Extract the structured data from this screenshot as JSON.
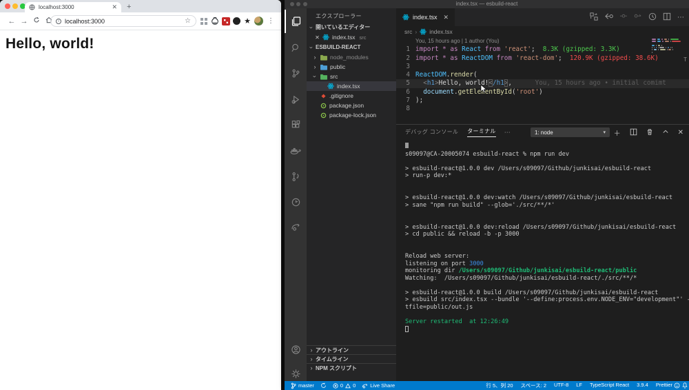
{
  "colors": {
    "statusbar": "#007ACC",
    "accent_blue": "#3B8EEA",
    "accent_green": "#1FBD77",
    "import_ok": "#4EC94E",
    "import_big": "#F14C4C",
    "react_icon": "#00B7E3"
  },
  "browser": {
    "tab_title": "localhost:3000",
    "url": "localhost:3000",
    "heading": "Hello, world!",
    "toolbar_icons": [
      "back",
      "forward",
      "reload",
      "home",
      "star",
      "grid-extension",
      "github-extension",
      "red-extension",
      "dot-extension",
      "star-extension",
      "avatar",
      "menu"
    ]
  },
  "vscode": {
    "window_title": "index.tsx — esbuild-react",
    "activity_icons": [
      "explorer",
      "search",
      "source-control",
      "run-debug",
      "extensions",
      "docker",
      "gitlens",
      "timer",
      "live-share",
      "account",
      "settings"
    ],
    "explorer": {
      "title": "エクスプローラー",
      "open_editors_label": "開いているエディター",
      "workspace_label": "ESBUILD-REACT",
      "open_editor": {
        "file": "index.tsx",
        "folder": "src"
      },
      "tree": [
        {
          "chev": ">",
          "icon": "folder-green",
          "label": "node_modules",
          "dim": true,
          "indent": 8
        },
        {
          "chev": ">",
          "icon": "folder-blue",
          "label": "public",
          "indent": 8
        },
        {
          "chev": "v",
          "icon": "folder-green2",
          "label": "src",
          "indent": 8
        },
        {
          "icon": "react",
          "label": "index.tsx",
          "selected": true,
          "indent": 30
        },
        {
          "icon": "git",
          "label": ".gitignore",
          "indent": 20
        },
        {
          "icon": "npm",
          "label": "package.json",
          "indent": 20
        },
        {
          "icon": "npm",
          "label": "package-lock.json",
          "indent": 20
        }
      ],
      "bottom_sections": [
        "アウトライン",
        "タイムライン",
        "NPM スクリプト"
      ]
    },
    "editor": {
      "tab_label": "index.tsx",
      "breadcrumb": [
        "src",
        "index.tsx"
      ],
      "code": [
        {
          "n": "",
          "seg": [
            [
              "lens",
              "You, 15 hours ago | 1 author (You)"
            ]
          ],
          "lens": true
        },
        {
          "n": "1",
          "seg": [
            [
              "kw",
              "import * as"
            ],
            [
              "ty",
              " React "
            ],
            [
              "kw",
              "from"
            ],
            [
              "st",
              " 'react'"
            ],
            [
              "pl",
              ";"
            ],
            [
              "ang",
              "  8.3K (gzipped: 3.3K)"
            ]
          ]
        },
        {
          "n": "2",
          "seg": [
            [
              "kw",
              "import * as"
            ],
            [
              "ty",
              " ReactDOM "
            ],
            [
              "kw",
              "from"
            ],
            [
              "st",
              " 'react-dom'"
            ],
            [
              "pl",
              ";"
            ],
            [
              "anr",
              "  120.9K (gzipped: 38.6K)"
            ]
          ]
        },
        {
          "n": "3",
          "seg": []
        },
        {
          "n": "4",
          "seg": [
            [
              "ty",
              "ReactDOM"
            ],
            [
              "pl",
              "."
            ],
            [
              "fn",
              "render"
            ],
            [
              "pl",
              "("
            ]
          ]
        },
        {
          "n": "5",
          "seg": [
            [
              "pl",
              "  "
            ],
            [
              "tb",
              "<"
            ],
            [
              "tg",
              "h1"
            ],
            [
              "tb",
              ">"
            ],
            [
              "tx",
              "Hello, world!"
            ],
            [
              "tbx",
              "<"
            ],
            [
              "tg",
              "/h1"
            ],
            [
              "tbx",
              ">"
            ],
            [
              "pl",
              ","
            ],
            [
              "blame",
              "      You, 15 hours ago • initial comimt"
            ]
          ],
          "current": true
        },
        {
          "n": "6",
          "seg": [
            [
              "pl",
              "  "
            ],
            [
              "vr",
              "document"
            ],
            [
              "pl",
              "."
            ],
            [
              "fn",
              "getElementById"
            ],
            [
              "pl",
              "("
            ],
            [
              "st",
              "'root'"
            ],
            [
              "pl",
              ")"
            ]
          ]
        },
        {
          "n": "7",
          "seg": [
            [
              "pl",
              ");"
            ]
          ]
        },
        {
          "n": "8",
          "seg": []
        }
      ]
    },
    "panel": {
      "tab_debug": "デバッグ コンソール",
      "tab_terminal": "ターミナル",
      "more": "⋯",
      "dropdown_value": "1: node",
      "terminal": [
        [
          [
            "blk",
            ""
          ]
        ],
        [
          [
            "t",
            "s09097@CA-20005074 esbuild-react % npm run dev"
          ]
        ],
        [],
        [
          [
            "t",
            "> esbuild-react@1.0.0 dev /Users/s09097/Github/junkisai/esbuild-react"
          ]
        ],
        [
          [
            "t",
            "> run-p dev:*"
          ]
        ],
        [],
        [],
        [
          [
            "t",
            "> esbuild-react@1.0.0 dev:watch /Users/s09097/Github/junkisai/esbuild-react"
          ]
        ],
        [
          [
            "t",
            "> sane \"npm run build\" --glob='./src/**/*'"
          ]
        ],
        [],
        [],
        [
          [
            "t",
            "> esbuild-react@1.0.0 dev:reload /Users/s09097/Github/junkisai/esbuild-react"
          ]
        ],
        [
          [
            "t",
            "> cd public && reload -b -p 3000"
          ]
        ],
        [],
        [],
        [
          [
            "t",
            "Reload web server:"
          ]
        ],
        [
          [
            "t",
            "listening on port "
          ],
          [
            "b",
            "3000"
          ]
        ],
        [
          [
            "t",
            "monitoring dir "
          ],
          [
            "gb",
            "/Users/s09097/Github/junkisai/esbuild-react/public"
          ]
        ],
        [
          [
            "t",
            "Watching:  /Users/s09097/Github/junkisai/esbuild-react/./src/**/*"
          ]
        ],
        [],
        [
          [
            "t",
            "> esbuild-react@1.0.0 build /Users/s09097/Github/junkisai/esbuild-react"
          ]
        ],
        [
          [
            "t",
            "> esbuild src/index.tsx --bundle '--define:process.env.NODE_ENV=\"development\"' --ou"
          ]
        ],
        [
          [
            "t",
            "tfile=public/out.js"
          ]
        ],
        [],
        [
          [
            "g",
            "Server restarted  at 12:26:49"
          ]
        ],
        [
          [
            "cur",
            ""
          ]
        ]
      ]
    },
    "statusbar": {
      "branch": "master",
      "errors": "0",
      "warnings": "0",
      "live_share": "Live Share",
      "right_items": [
        "行 5、列 20",
        "スペース: 2",
        "UTF-8",
        "LF",
        "TypeScript React",
        "3.9.4",
        "Prettier"
      ]
    }
  }
}
